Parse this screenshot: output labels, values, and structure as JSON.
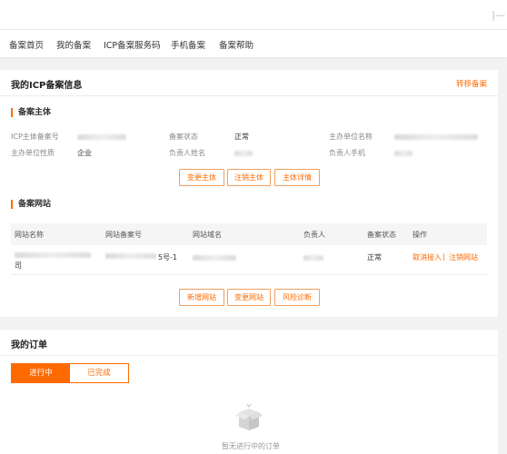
{
  "nav": {
    "items": [
      "备案首页",
      "我的备案",
      "ICP备案服务码",
      "手机备案",
      "备案帮助"
    ]
  },
  "icp": {
    "title": "我的ICP备案信息",
    "transfer_link": "转移备案",
    "subject": {
      "section_title": "备案主体",
      "fields": {
        "icp_no_label": "ICP主体备案号",
        "status_label": "备案状态",
        "status_value": "正常",
        "org_name_label": "主办单位名称",
        "org_type_label": "主办单位性质",
        "org_type_value": "企业",
        "owner_name_label": "负责人姓名",
        "owner_phone_label": "负责人手机"
      },
      "buttons": {
        "change": "变更主体",
        "cancel": "注销主体",
        "detail": "主体详情"
      }
    },
    "site": {
      "section_title": "备案网站",
      "columns": [
        "网站名称",
        "网站备案号",
        "网站域名",
        "负责人",
        "备案状态",
        "操作"
      ],
      "row": {
        "name_suffix": "司",
        "record_suffix": "5号-1",
        "status": "正常",
        "action_unlink": "取消接入",
        "action_sep": "|",
        "action_cancel": "注销网站"
      },
      "buttons": {
        "add": "新增网站",
        "change": "变更网站",
        "risk": "风险诊断"
      }
    }
  },
  "orders": {
    "title": "我的订单",
    "tabs": [
      "进行中",
      "已完成"
    ],
    "empty_text": "暂无进行中的订单"
  },
  "colors": {
    "accent": "#ff6a00",
    "background": "#f2f2f2"
  }
}
